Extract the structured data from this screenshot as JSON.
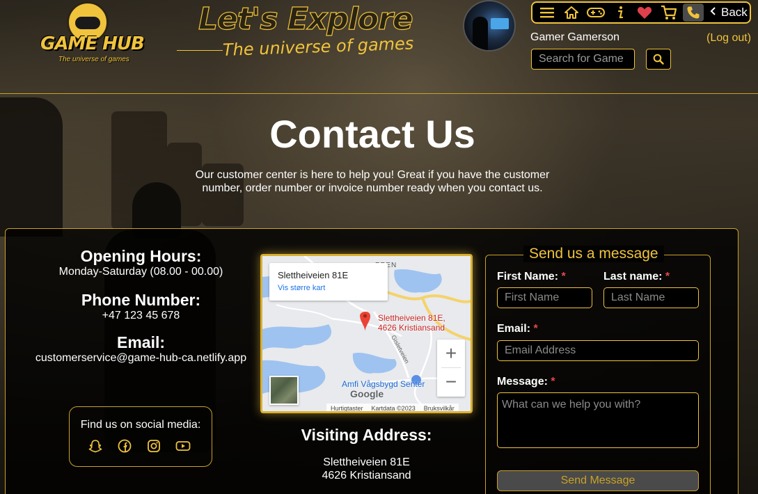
{
  "brand": {
    "logo_text": "GAME HUB",
    "logo_tagline": "The universe of games",
    "headline": "Let's Explore",
    "subheadline": "The universe of games"
  },
  "nav": {
    "icons": [
      "menu-icon",
      "home-icon",
      "gamepad-icon",
      "info-icon",
      "heart-icon",
      "cart-icon",
      "phone-icon"
    ],
    "active": "phone-icon",
    "back_label": "Back"
  },
  "user": {
    "name": "Gamer Gamerson",
    "logout_label": "(Log out)"
  },
  "search": {
    "placeholder": "Search for Game",
    "value": ""
  },
  "page": {
    "title": "Contact Us",
    "intro": "Our customer center is here to help you! Great if you have the customer number, order number or invoice number ready when you contact us."
  },
  "info": {
    "hours_heading": "Opening Hours:",
    "hours_value": "Monday-Saturday (08.00 - 00.00)",
    "phone_heading": "Phone Number:",
    "phone_value": "+47 123 45 678",
    "email_heading": "Email:",
    "email_value": "customerservice@game-hub-ca.netlify.app"
  },
  "social": {
    "label": "Find us on social media:",
    "icons": [
      "snapchat-icon",
      "facebook-icon",
      "instagram-icon",
      "youtube-icon"
    ]
  },
  "map": {
    "card_title": "Slettheiveien 81E",
    "card_link": "Vis større kart",
    "pin_label_line1": "Slettheiveien 81E,",
    "pin_label_line2": "4626 Kristiansand",
    "area_label": "Amfi Vågsbygd Senter",
    "street_label": "Gisletveien",
    "top_label": "PPEN",
    "google": "Google",
    "footer": [
      "Hurtigtaster",
      "Kartdata ©2023",
      "Bruksvilkår"
    ]
  },
  "visit": {
    "heading": "Visiting Address:",
    "line1": "Slettheiveien 81E",
    "line2": "4626 Kristiansand"
  },
  "form": {
    "legend": "Send us a message",
    "first_name_label": "First Name:",
    "first_name_placeholder": "First Name",
    "last_name_label": "Last name:",
    "last_name_placeholder": "Last Name",
    "email_label": "Email:",
    "email_placeholder": "Email Address",
    "message_label": "Message:",
    "message_placeholder": "What can we help you with?",
    "required_mark": "*",
    "submit_label": "Send Message"
  },
  "colors": {
    "accent": "#f0c33c",
    "border": "#c9a227",
    "required": "#e5484d"
  }
}
